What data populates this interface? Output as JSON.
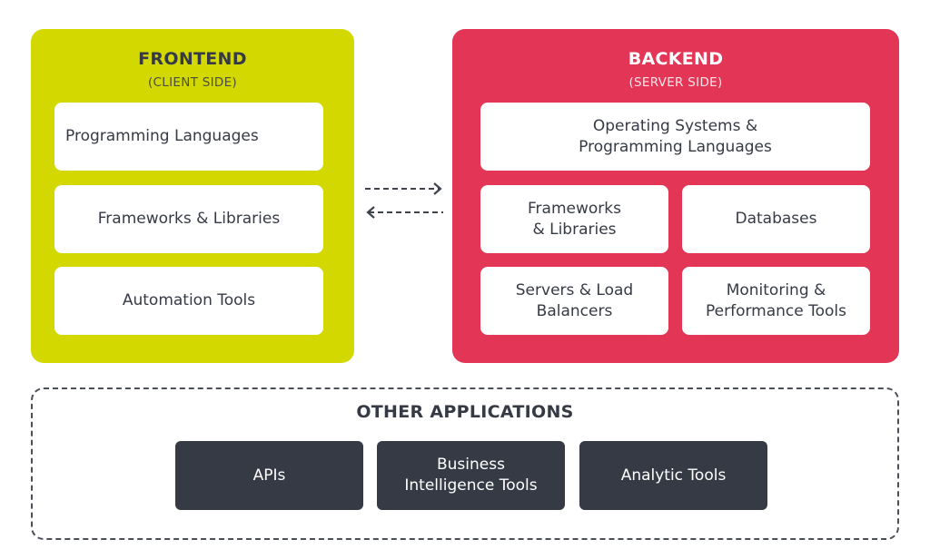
{
  "frontend": {
    "title": "FRONTEND",
    "subtitle": "(CLIENT SIDE)",
    "color": "#d3d800",
    "items": [
      "Programming Languages",
      "Frameworks & Libraries",
      "Automation Tools"
    ]
  },
  "backend": {
    "title": "BACKEND",
    "subtitle": "(SERVER SIDE)",
    "color": "#e33656",
    "items": [
      "Operating Systems &\nProgramming Languages",
      "Frameworks\n& Libraries",
      "Databases",
      "Servers & Load\nBalancers",
      "Monitoring &\nPerformance Tools"
    ]
  },
  "connection": {
    "icons": [
      "dashed-arrow-right-icon",
      "dashed-arrow-left-icon"
    ]
  },
  "other": {
    "title": "OTHER APPLICATIONS",
    "color": "#353a45",
    "items": [
      "APIs",
      "Business\nIntelligence Tools",
      "Analytic Tools"
    ]
  }
}
